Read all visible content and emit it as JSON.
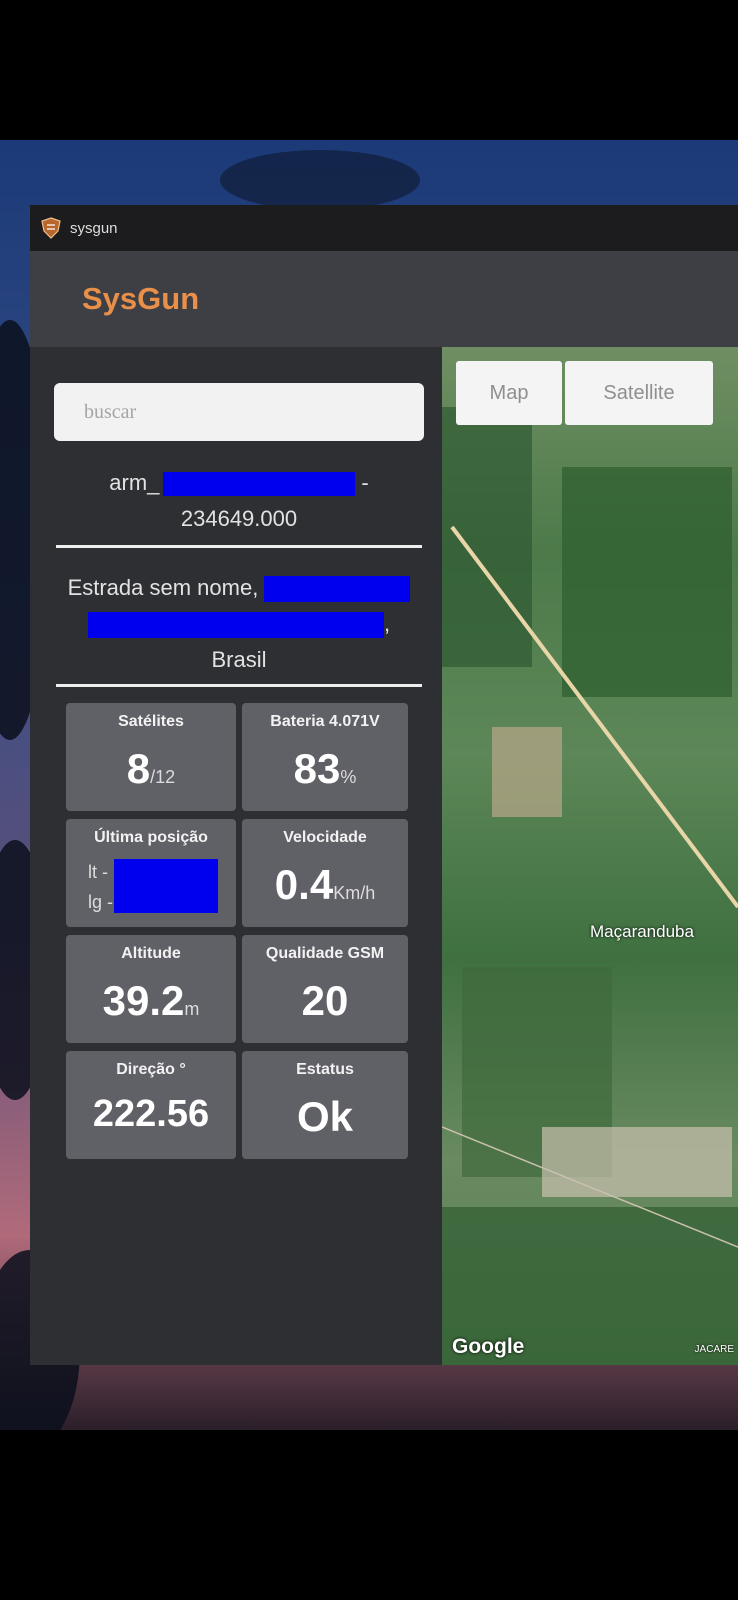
{
  "window": {
    "app_name": "sysgun"
  },
  "header": {
    "brand": "SysGun"
  },
  "search": {
    "placeholder": "buscar"
  },
  "device": {
    "id_prefix": "arm_",
    "id_suffix": "-",
    "line2": "234649.000"
  },
  "address": {
    "line1": "Estrada sem nome, ",
    "line2_suffix": ",",
    "line3": "Brasil"
  },
  "tiles": {
    "satellites": {
      "label": "Satélites",
      "value": "8",
      "unit": "/12"
    },
    "battery": {
      "label": "Bateria 4.071V",
      "value": "83",
      "unit": "%"
    },
    "last_position": {
      "label": "Última posição",
      "lat_prefix": "lt -",
      "lng_prefix": "lg -"
    },
    "speed": {
      "label": "Velocidade",
      "value": "0.4",
      "unit": "Km/h"
    },
    "altitude": {
      "label": "Altitude",
      "value": "39.2",
      "unit": "m"
    },
    "gsm": {
      "label": "Qualidade GSM",
      "value": "20"
    },
    "direction": {
      "label": "Direção °",
      "value": "222.56"
    },
    "status": {
      "label": "Estatus",
      "value": "Ok"
    }
  },
  "map": {
    "type_options": [
      "Map",
      "Satellite"
    ],
    "place_label": "Maçaranduba",
    "attribution": "Google",
    "corner_label": "JACARE"
  }
}
